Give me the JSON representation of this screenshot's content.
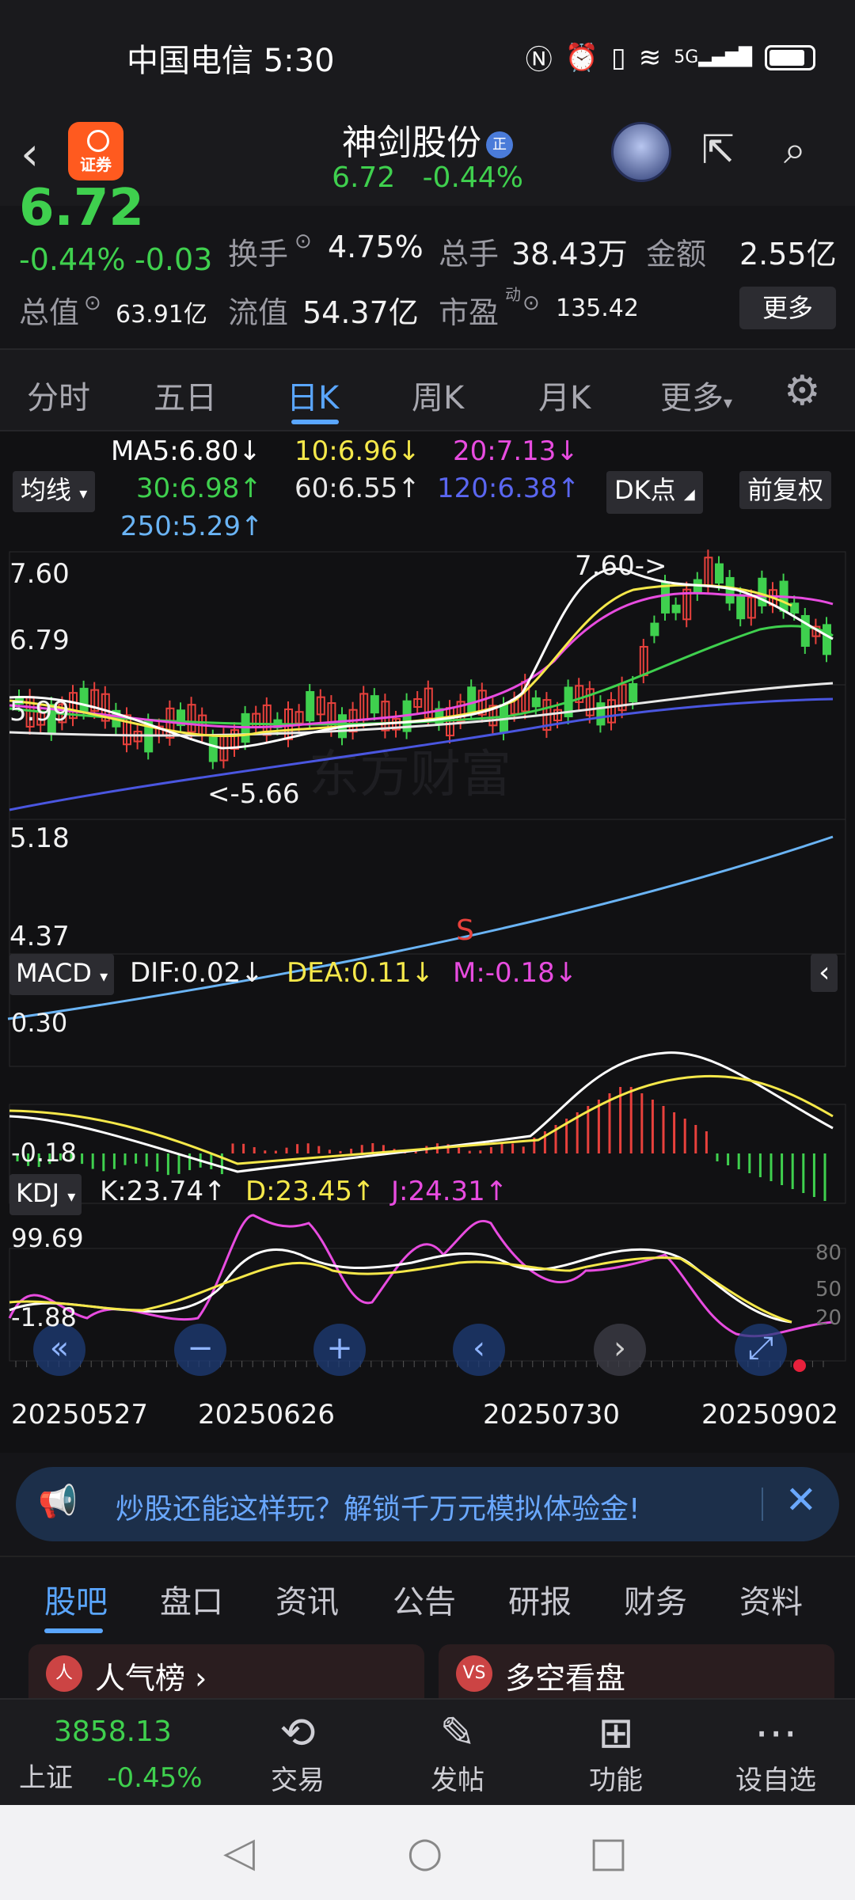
{
  "status": {
    "carrier_time": "中国电信 5:30",
    "icons": [
      "nfc-icon",
      "alarm-icon",
      "vibrate-icon",
      "wifi-icon",
      "5g-signal-icon",
      "battery-icon"
    ]
  },
  "header": {
    "logo_text": "证券",
    "stock_name": "神剑股份",
    "badge": "正",
    "price": "6.72",
    "change_pct": "-0.44%"
  },
  "quote": {
    "big_price": "6.72",
    "pct": "-0.44%",
    "chg": "-0.03",
    "turnover_label": "换手",
    "turnover": "4.75%",
    "vol_label": "总手",
    "vol": "38.43万",
    "amt_label": "金额",
    "amt": "2.55亿",
    "mcap_label": "总值",
    "mcap": "63.91亿",
    "float_label": "流值",
    "float": "54.37亿",
    "pe_label": "市盈",
    "pe_sup": "动",
    "pe": "135.42",
    "more": "更多"
  },
  "tabs": [
    "分时",
    "五日",
    "日K",
    "周K",
    "月K",
    "更多"
  ],
  "ma": {
    "chip": "均线",
    "ma5": "MA5:6.80↓",
    "ma10": "10:6.96↓",
    "ma20": "20:7.13↓",
    "ma30": "30:6.98↑",
    "ma60": "60:6.55↑",
    "ma120": "120:6.38↑",
    "ma250": "250:5.29↑",
    "dk": "DK点",
    "fq": "前复权"
  },
  "kline": {
    "y_labels": [
      "7.60",
      "6.79",
      "5.99",
      "5.18",
      "4.37"
    ],
    "high_ann": "7.60->",
    "low_ann": "<-5.66",
    "s_mark": "S"
  },
  "macd": {
    "chip": "MACD",
    "dif": "DIF:0.02↓",
    "dea": "DEA:0.11↓",
    "m": "M:-0.18↓",
    "y_top": "0.30",
    "y_bot": "-0.18"
  },
  "kdj": {
    "chip": "KDJ",
    "k": "K:23.74↑",
    "d": "D:23.45↑",
    "j": "J:24.31↑",
    "y_top": "99.69",
    "y_bot": "-1.88",
    "levels": [
      "80",
      "50",
      "20"
    ]
  },
  "dates": [
    "20250527",
    "20250626",
    "20250730",
    "20250902"
  ],
  "banner": {
    "text": "炒股还能这样玩？解锁千万元模拟体验金!"
  },
  "btabs": [
    "股吧",
    "盘口",
    "资讯",
    "公告",
    "研报",
    "财务",
    "资料"
  ],
  "cards": [
    {
      "icon": "人",
      "title": "人气榜 ›"
    },
    {
      "icon": "VS",
      "title": "多空看盘"
    }
  ],
  "bottom": {
    "index_value": "3858.13",
    "index_name": "上证",
    "index_pct": "-0.45%",
    "items": [
      "交易",
      "发帖",
      "功能",
      "设自选"
    ]
  },
  "colors": {
    "up": "#e8413c",
    "down": "#3fd04e",
    "accent": "#5aa6ff",
    "ma5": "#ffffff",
    "ma10": "#f5e84a",
    "ma20": "#e84ce0",
    "ma30": "#3fd04e",
    "ma60": "#e8e8e8",
    "ma120": "#4a56e0",
    "ma250": "#6ab4f5"
  }
}
